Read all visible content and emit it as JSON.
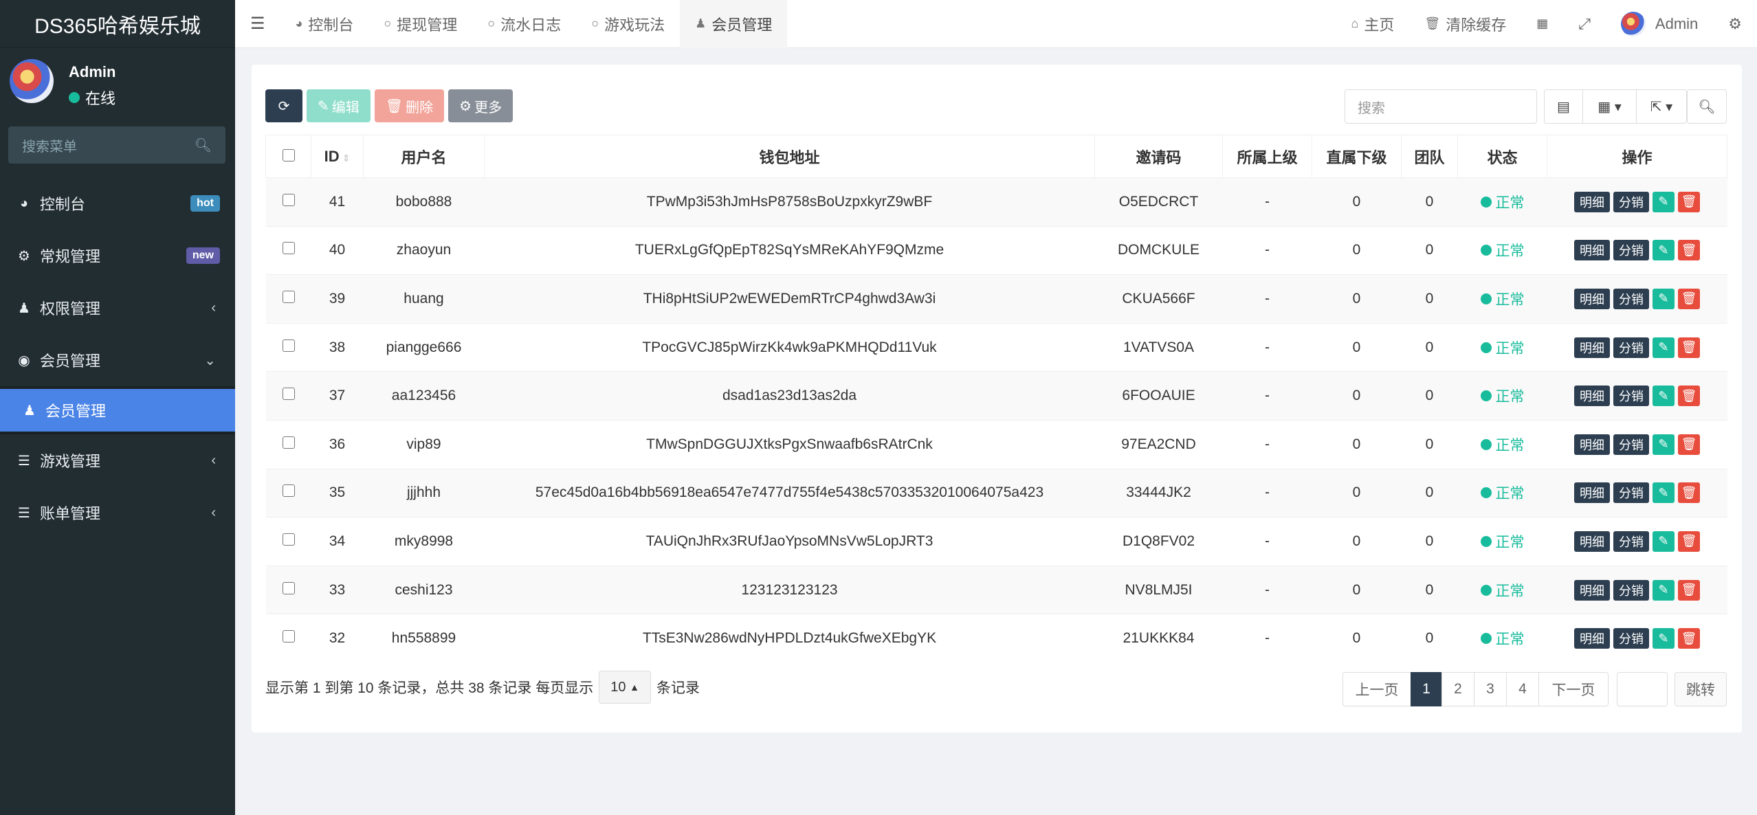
{
  "brand": "DS365哈希娱乐城",
  "user": {
    "name": "Admin",
    "status": "在线"
  },
  "sidebar_search_placeholder": "搜索菜单",
  "menu": [
    {
      "icon": "dashboard-icon",
      "label": "控制台",
      "badge": "hot",
      "badge_color": "#3c8dbc"
    },
    {
      "icon": "cogs-icon",
      "label": "常规管理",
      "badge": "new",
      "badge_color": "#605ca8"
    },
    {
      "icon": "users-icon",
      "label": "权限管理"
    },
    {
      "icon": "user-circle-icon",
      "label": "会员管理"
    },
    {
      "icon": "user-icon",
      "label": "会员管理"
    },
    {
      "icon": "list-icon",
      "label": "游戏管理"
    },
    {
      "icon": "list-icon",
      "label": "账单管理"
    }
  ],
  "tabs": [
    "控制台",
    "提现管理",
    "流水日志",
    "游戏玩法",
    "会员管理"
  ],
  "topbar_right": {
    "home": "主页",
    "clear_cache": "清除缓存",
    "admin": "Admin"
  },
  "toolbar": {
    "edit": "编辑",
    "delete": "删除",
    "more": "更多"
  },
  "search_placeholder": "搜索",
  "table": {
    "headers": [
      "ID",
      "用户名",
      "钱包地址",
      "邀请码",
      "所属上级",
      "直属下级",
      "团队",
      "状态",
      "操作"
    ],
    "rows": [
      {
        "id": "41",
        "username": "bobo888",
        "wallet": "TPwMp3i53hJmHsP8758sBoUzpxkyrZ9wBF",
        "invite": "O5EDCRCT",
        "parent": "-",
        "direct": "0",
        "team": "0",
        "status": "正常"
      },
      {
        "id": "40",
        "username": "zhaoyun",
        "wallet": "TUERxLgGfQpEpT82SqYsMReKAhYF9QMzme",
        "invite": "DOMCKULE",
        "parent": "-",
        "direct": "0",
        "team": "0",
        "status": "正常"
      },
      {
        "id": "39",
        "username": "huang",
        "wallet": "THi8pHtSiUP2wEWEDemRTrCP4ghwd3Aw3i",
        "invite": "CKUA566F",
        "parent": "-",
        "direct": "0",
        "team": "0",
        "status": "正常"
      },
      {
        "id": "38",
        "username": "piangge666",
        "wallet": "TPocGVCJ85pWirzKk4wk9aPKMHQDd11Vuk",
        "invite": "1VATVS0A",
        "parent": "-",
        "direct": "0",
        "team": "0",
        "status": "正常"
      },
      {
        "id": "37",
        "username": "aa123456",
        "wallet": "dsad1as23d13as2da",
        "invite": "6FOOAUIE",
        "parent": "-",
        "direct": "0",
        "team": "0",
        "status": "正常"
      },
      {
        "id": "36",
        "username": "vip89",
        "wallet": "TMwSpnDGGUJXtksPgxSnwaafb6sRAtrCnk",
        "invite": "97EA2CND",
        "parent": "-",
        "direct": "0",
        "team": "0",
        "status": "正常"
      },
      {
        "id": "35",
        "username": "jjjhhh",
        "wallet": "57ec45d0a16b4bb56918ea6547e7477d755f4e5438c57033532010064075a423",
        "invite": "33444JK2",
        "parent": "-",
        "direct": "0",
        "team": "0",
        "status": "正常"
      },
      {
        "id": "34",
        "username": "mky8998",
        "wallet": "TAUiQnJhRx3RUfJaoYpsoMNsVw5LopJRT3",
        "invite": "D1Q8FV02",
        "parent": "-",
        "direct": "0",
        "team": "0",
        "status": "正常"
      },
      {
        "id": "33",
        "username": "ceshi123",
        "wallet": "123123123123",
        "invite": "NV8LMJ5I",
        "parent": "-",
        "direct": "0",
        "team": "0",
        "status": "正常"
      },
      {
        "id": "32",
        "username": "hn558899",
        "wallet": "TTsE3Nw286wdNyHPDLDzt4ukGfweXEbgYK",
        "invite": "21UKKK84",
        "parent": "-",
        "direct": "0",
        "team": "0",
        "status": "正常"
      }
    ],
    "row_actions": {
      "detail": "明细",
      "split": "分销"
    }
  },
  "footer": {
    "summary_prefix": "显示第 1 到第 10 条记录，总共 38 条记录 每页显示",
    "page_size": "10",
    "summary_suffix": "条记录",
    "prev": "上一页",
    "pages": [
      "1",
      "2",
      "3",
      "4"
    ],
    "next": "下一页",
    "jump": "跳转"
  },
  "colors": {
    "sidebar_bg": "#222d32",
    "active_menu": "#4a84e6",
    "success": "#18bc9c",
    "danger": "#e74c3c",
    "dark": "#2c3e50"
  }
}
